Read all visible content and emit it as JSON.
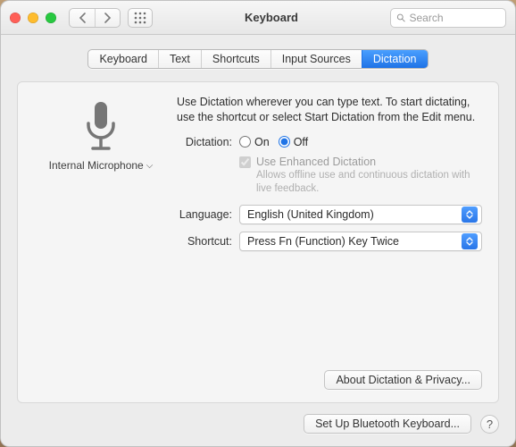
{
  "window": {
    "title": "Keyboard"
  },
  "search": {
    "placeholder": "Search"
  },
  "tabs": {
    "items": [
      {
        "label": "Keyboard"
      },
      {
        "label": "Text"
      },
      {
        "label": "Shortcuts"
      },
      {
        "label": "Input Sources"
      },
      {
        "label": "Dictation"
      }
    ],
    "active_index": 4
  },
  "left": {
    "mic_label": "Internal Microphone"
  },
  "intro": "Use Dictation wherever you can type text. To start dictating, use the shortcut or select Start Dictation from the Edit menu.",
  "dictation": {
    "row_label": "Dictation:",
    "on_label": "On",
    "off_label": "Off",
    "selected": "off",
    "enhanced_label": "Use Enhanced Dictation",
    "enhanced_desc": "Allows offline use and continuous dictation with live feedback.",
    "enhanced_checked": true
  },
  "language": {
    "row_label": "Language:",
    "value": "English (United Kingdom)"
  },
  "shortcut": {
    "row_label": "Shortcut:",
    "value": "Press Fn (Function) Key Twice"
  },
  "buttons": {
    "about": "About Dictation & Privacy...",
    "bluetooth": "Set Up Bluetooth Keyboard...",
    "help": "?"
  }
}
